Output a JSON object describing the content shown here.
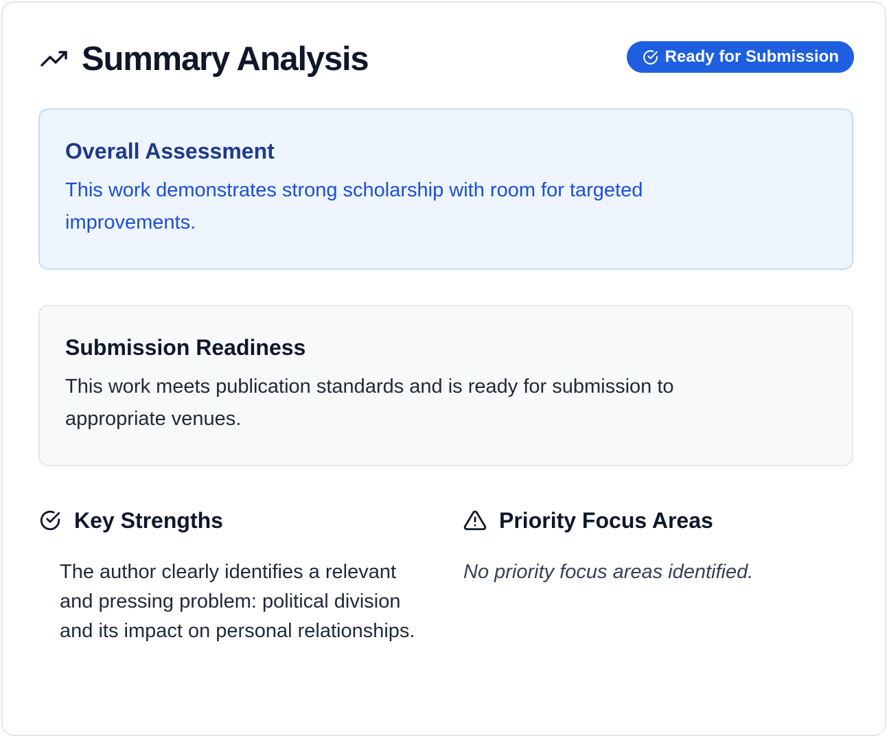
{
  "header": {
    "title": "Summary Analysis",
    "title_icon": "trending-up-icon",
    "badge_label": "Ready for Submission",
    "badge_icon": "check-circle-icon"
  },
  "assessment": {
    "title": "Overall Assessment",
    "text": "This work demonstrates strong scholarship with room for targeted improvements."
  },
  "readiness": {
    "title": "Submission Readiness",
    "text": "This work meets publication standards and is ready for submission to appropriate venues."
  },
  "strengths": {
    "title": "Key Strengths",
    "icon": "check-circle-icon",
    "items": [
      {
        "text": "The author clearly identifies a relevant and pressing problem: political division and its impact on personal relationships."
      }
    ]
  },
  "priority": {
    "title": "Priority Focus Areas",
    "icon": "warning-triangle-icon",
    "empty_text": "No priority focus areas identified."
  },
  "colors": {
    "accent": "#1d5fe0",
    "assessment_bg": "#eef5ff",
    "assessment_border": "#bfdbfe",
    "assessment_title": "#1e3a8a",
    "assessment_text": "#1d4ed8",
    "readiness_bg": "#f8f9fb",
    "border": "#e5e7eb",
    "text_dark": "#0f172a"
  }
}
